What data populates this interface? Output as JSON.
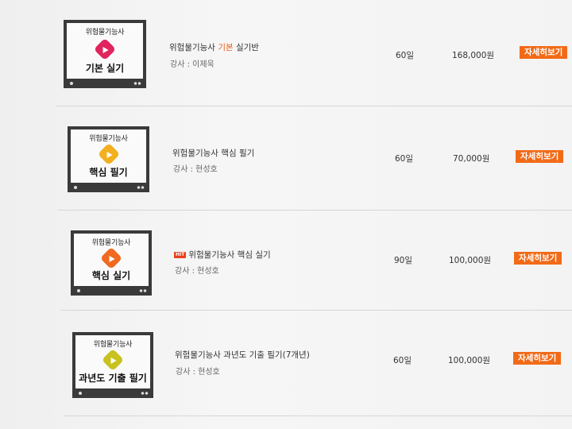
{
  "courses": [
    {
      "thumb_category": "위험물기능사",
      "thumb_label": "기본 실기",
      "play_color": "#e0245e",
      "title_pre": "위험물기능사 ",
      "title_hl": "기본",
      "title_post": " 실기반",
      "hit": false,
      "instructor": "강사 : 이제욱",
      "duration": "60일",
      "price": "168,000원",
      "button": "자세히보기"
    },
    {
      "thumb_category": "위험물기능사",
      "thumb_label": "핵심 필기",
      "play_color": "#f2b01e",
      "title_pre": "위험물기능사 핵심 필기",
      "title_hl": "",
      "title_post": "",
      "hit": false,
      "instructor": "강사 : 현성호",
      "duration": "60일",
      "price": "70,000원",
      "button": "자세히보기"
    },
    {
      "thumb_category": "위험물기능사",
      "thumb_label": "핵심 실기",
      "play_color": "#f06a22",
      "title_pre": "위험물기능사 핵심 실기",
      "title_hl": "",
      "title_post": "",
      "hit": true,
      "hit_label": "HIT",
      "instructor": "강사 : 현성호",
      "duration": "90일",
      "price": "100,000원",
      "button": "자세히보기"
    },
    {
      "thumb_category": "위험물기능사",
      "thumb_label": "과년도 기출 필기",
      "play_color": "#c8c21e",
      "title_pre": "위험물기능사 과년도 기출 필기(7개년)",
      "title_hl": "",
      "title_post": "",
      "hit": false,
      "instructor": "강사 : 현성호",
      "duration": "60일",
      "price": "100,000원",
      "button": "자세히보기"
    }
  ]
}
